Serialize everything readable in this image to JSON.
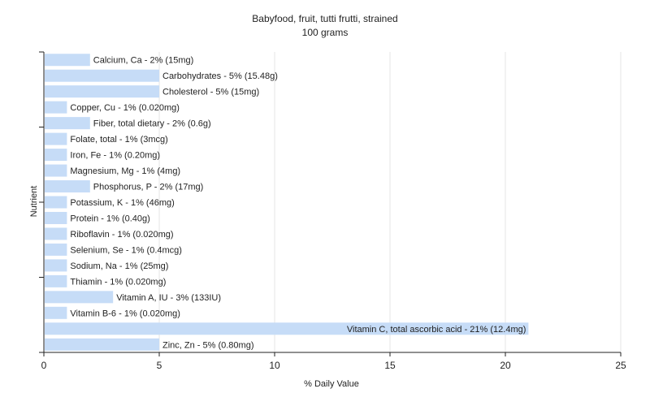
{
  "chart_data": {
    "type": "bar",
    "orientation": "horizontal",
    "title": "Babyfood, fruit, tutti frutti, strained",
    "subtitle": "100 grams",
    "xlabel": "% Daily Value",
    "ylabel": "Nutrient",
    "xlim": [
      0,
      25
    ],
    "xticks": [
      0,
      5,
      10,
      15,
      20,
      25
    ],
    "grid": true,
    "bar_color": "#c6dcf7",
    "categories": [
      "Calcium, Ca",
      "Carbohydrates",
      "Cholesterol",
      "Copper, Cu",
      "Fiber, total dietary",
      "Folate, total",
      "Iron, Fe",
      "Magnesium, Mg",
      "Phosphorus, P",
      "Potassium, K",
      "Protein",
      "Riboflavin",
      "Selenium, Se",
      "Sodium, Na",
      "Thiamin",
      "Vitamin A, IU",
      "Vitamin B-6",
      "Vitamin C, total ascorbic acid",
      "Zinc, Zn"
    ],
    "values": [
      2,
      5,
      5,
      1,
      2,
      1,
      1,
      1,
      2,
      1,
      1,
      1,
      1,
      1,
      1,
      3,
      1,
      21,
      5
    ],
    "labels": [
      "Calcium, Ca - 2% (15mg)",
      "Carbohydrates - 5% (15.48g)",
      "Cholesterol - 5% (15mg)",
      "Copper, Cu - 1% (0.020mg)",
      "Fiber, total dietary - 2% (0.6g)",
      "Folate, total - 1% (3mcg)",
      "Iron, Fe - 1% (0.20mg)",
      "Magnesium, Mg - 1% (4mg)",
      "Phosphorus, P - 2% (17mg)",
      "Potassium, K - 1% (46mg)",
      "Protein - 1% (0.40g)",
      "Riboflavin - 1% (0.020mg)",
      "Selenium, Se - 1% (0.4mcg)",
      "Sodium, Na - 1% (25mg)",
      "Thiamin - 1% (0.020mg)",
      "Vitamin A, IU - 3% (133IU)",
      "Vitamin B-6 - 1% (0.020mg)",
      "Vitamin C, total ascorbic acid - 21% (12.4mg)",
      "Zinc, Zn - 5% (0.80mg)"
    ]
  }
}
